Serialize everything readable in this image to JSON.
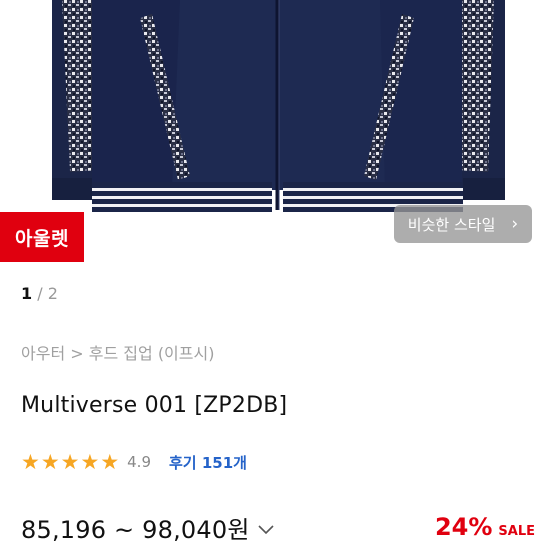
{
  "product_image": {
    "icon": "jacket-product-photo"
  },
  "badge": {
    "label": "아울렛"
  },
  "similar_style": {
    "label": "비슷한 스타일",
    "icon": "chevron-right-icon"
  },
  "pager": {
    "current": "1",
    "separator": " / ",
    "total": "2"
  },
  "breadcrumb": {
    "category": "아우터",
    "separator": ">",
    "subcategory": "후드 집업 (이프시)"
  },
  "product": {
    "title": "Multiverse 001 [ZP2DB]"
  },
  "rating": {
    "stars": 5,
    "score": "4.9",
    "reviews_label": "후기 151개"
  },
  "price": {
    "range": "85,196 ~ 98,040원",
    "icon": "chevron-down-icon"
  },
  "discount": {
    "percent": "24%",
    "label": "SALE"
  },
  "colors": {
    "accent_red": "#e0000f",
    "star": "#f6a623",
    "link_blue": "#2563c9"
  }
}
